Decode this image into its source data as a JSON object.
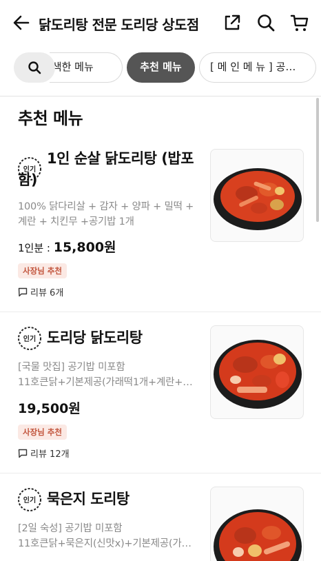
{
  "header": {
    "store_name": "닭도리탕 전문 도리당 상도점",
    "back_icon": "arrow-left-icon",
    "share_icon": "share-icon",
    "search_icon": "search-icon",
    "cart_icon": "cart-icon"
  },
  "filters": {
    "items": [
      {
        "label": "검색한 메뉴"
      },
      {
        "label": "추천 메뉴",
        "active": true
      },
      {
        "label": "[ 메 인 메 뉴 ] 공기밥 미포함"
      }
    ]
  },
  "section": {
    "title": "추천 메뉴"
  },
  "menu": [
    {
      "badge": "인기",
      "name": "1인 순살 닭도리탕 (밥포함)",
      "description": "100% 닭다리살 + 감자 + 양파 + 밀떡 + 계란 + 치킨무 +공기밥 1개",
      "price_prefix": "1인분 : ",
      "price": "15,800원",
      "tag": "사장님 추천",
      "review": "리뷰 6개"
    },
    {
      "badge": "인기",
      "name": "도리당 닭도리탕",
      "description_lines": [
        "[국물 맛집] 공기밥 미포함",
        "11호큰닭+기본제공(가래떡1개+계란+…"
      ],
      "price": "19,500원",
      "tag": "사장님 추천",
      "review": "리뷰 12개"
    },
    {
      "badge": "인기",
      "name": "묵은지 도리탕",
      "description_lines": [
        "[2일 숙성] 공기밥 미포함",
        "11호큰닭+묵은지(신맛x)+기본제공(가…"
      ]
    }
  ],
  "colors": {
    "active_chip": "#555555",
    "tag_bg": "#fbe9e4",
    "tag_text": "#c2553d",
    "desc_text": "#8a8a8a"
  }
}
